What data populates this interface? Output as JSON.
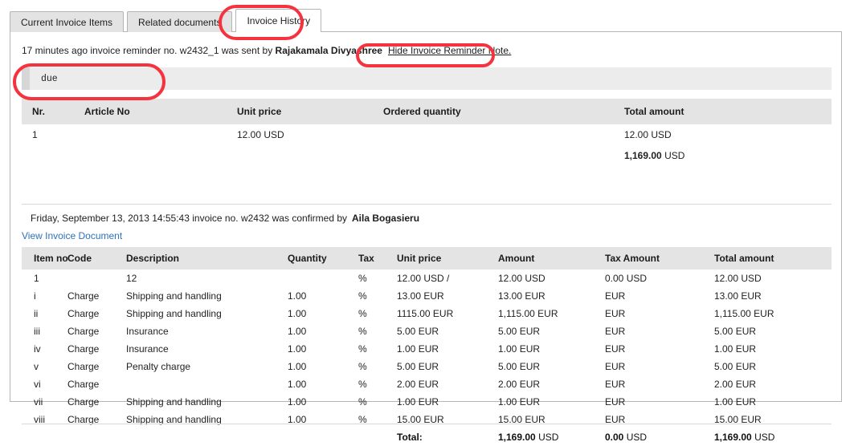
{
  "tabs": [
    {
      "label": "Current Invoice Items",
      "active": false
    },
    {
      "label": "Related documents",
      "active": false
    },
    {
      "label": "Invoice History",
      "active": true
    }
  ],
  "reminder": {
    "prefix": "17 minutes ago invoice reminder no. ",
    "number": "w2432_1",
    "middle": " was sent by ",
    "sender": "Rajakamala Divyashree",
    "toggle_link": "Hide Invoice Reminder Note.",
    "note_text": "due"
  },
  "reminder_table": {
    "headers": [
      "Nr.",
      "Article No",
      "Unit price",
      "Ordered quantity",
      "Total amount"
    ],
    "rows": [
      {
        "nr": "1",
        "article_no": "",
        "unit_price": "12.00  USD",
        "ordered_quantity": "",
        "total_amount": "12.00 USD"
      }
    ],
    "grand_total_amount": "1,169.00",
    "grand_total_currency": "USD"
  },
  "confirmation": {
    "date": "Friday, September 13, 2013 14:55:43",
    "middle": " invoice no.  w2432  was confirmed  by",
    "user": "Aila Bogasieru",
    "document_link": "View Invoice Document"
  },
  "items_table": {
    "headers": [
      "Item no",
      "Code",
      "Description",
      "Quantity",
      "Tax",
      "Unit price",
      "Amount",
      "Tax Amount",
      "Total amount"
    ],
    "rows": [
      {
        "item_no": "1",
        "code": "",
        "description": "12",
        "quantity": "",
        "tax": "%",
        "unit_price": "12.00  USD /",
        "amount": "12.00 USD",
        "tax_amount": "0.00 USD",
        "total_amount": "12.00 USD"
      },
      {
        "item_no": "i",
        "code": "Charge",
        "description": "Shipping and handling",
        "quantity": "1.00",
        "tax": "%",
        "unit_price": "13.00  EUR",
        "amount": "13.00 EUR",
        "tax_amount": "EUR",
        "total_amount": "13.00 EUR"
      },
      {
        "item_no": "ii",
        "code": "Charge",
        "description": "Shipping and handling",
        "quantity": "1.00",
        "tax": "%",
        "unit_price": "1115.00  EUR",
        "amount": "1,115.00 EUR",
        "tax_amount": "EUR",
        "total_amount": "1,115.00 EUR"
      },
      {
        "item_no": "iii",
        "code": "Charge",
        "description": "Insurance",
        "quantity": "1.00",
        "tax": "%",
        "unit_price": "5.00  EUR",
        "amount": "5.00 EUR",
        "tax_amount": "EUR",
        "total_amount": "5.00 EUR"
      },
      {
        "item_no": "iv",
        "code": "Charge",
        "description": "Insurance",
        "quantity": "1.00",
        "tax": "%",
        "unit_price": "1.00  EUR",
        "amount": "1.00 EUR",
        "tax_amount": "EUR",
        "total_amount": "1.00 EUR"
      },
      {
        "item_no": "v",
        "code": "Charge",
        "description": "Penalty charge",
        "quantity": "1.00",
        "tax": "%",
        "unit_price": "5.00  EUR",
        "amount": "5.00 EUR",
        "tax_amount": "EUR",
        "total_amount": "5.00 EUR"
      },
      {
        "item_no": "vi",
        "code": "Charge",
        "description": "",
        "quantity": "1.00",
        "tax": "%",
        "unit_price": "2.00  EUR",
        "amount": "2.00 EUR",
        "tax_amount": "EUR",
        "total_amount": "2.00 EUR"
      },
      {
        "item_no": "vii",
        "code": "Charge",
        "description": "Shipping and handling",
        "quantity": "1.00",
        "tax": "%",
        "unit_price": "1.00  EUR",
        "amount": "1.00 EUR",
        "tax_amount": "EUR",
        "total_amount": "1.00 EUR"
      },
      {
        "item_no": "viii",
        "code": "Charge",
        "description": "Shipping and handling",
        "quantity": "1.00",
        "tax": "%",
        "unit_price": "15.00  EUR",
        "amount": "15.00 EUR",
        "tax_amount": "EUR",
        "total_amount": "15.00 EUR"
      }
    ],
    "total": {
      "label": "Total:",
      "amount": "1,169.00",
      "amount_currency": "USD",
      "tax_amount": "0.00",
      "tax_amount_currency": "USD",
      "total_amount": "1,169.00",
      "total_amount_currency": "USD"
    }
  },
  "annotations": {
    "color": "#f5333f",
    "targets": [
      "Invoice History tab",
      "Hide Invoice Reminder Note. link",
      "reminder note box"
    ]
  }
}
